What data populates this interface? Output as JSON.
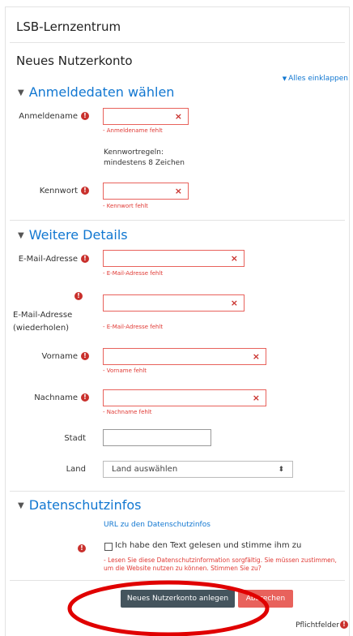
{
  "site": {
    "title": "LSB-Lernzentrum"
  },
  "page": {
    "title": "Neues Nutzerkonto",
    "collapse_all": "Alles einklappen"
  },
  "sections": {
    "login": {
      "title": "Anmeldedaten wählen",
      "username": {
        "label": "Anmeldename",
        "error": "- Anmeldename fehlt",
        "value": ""
      },
      "password_rules": "Kennwortregeln:",
      "password_rule_1": "mindestens 8 Zeichen",
      "password": {
        "label": "Kennwort",
        "error": "- Kennwort fehlt",
        "value": ""
      }
    },
    "details": {
      "title": "Weitere Details",
      "email": {
        "label": "E-Mail-Adresse",
        "error": "- E-Mail-Adresse fehlt"
      },
      "email2": {
        "label_line1": "E-Mail-Adresse",
        "label_line2": "(wiederholen)",
        "error": "- E-Mail-Adresse fehlt"
      },
      "firstname": {
        "label": "Vorname",
        "error": "- Vorname fehlt"
      },
      "lastname": {
        "label": "Nachname",
        "error": "- Nachname fehlt"
      },
      "city": {
        "label": "Stadt"
      },
      "country": {
        "label": "Land",
        "selected": "Land auswählen"
      }
    },
    "privacy": {
      "title": "Datenschutzinfos",
      "url_link": "URL zu den Datenschutzinfos",
      "agree_label": "Ich habe den Text gelesen und stimme ihm zu",
      "error": "- Lesen Sie diese Datenschutzinformation sorgfältig. Sie müssen zustimmen, um die Website nutzen zu können. Stimmen Sie zu?"
    }
  },
  "buttons": {
    "submit": "Neues Nutzerkonto anlegen",
    "cancel": "Abbrechen"
  },
  "footer": {
    "required_legend": "Pflichtfelder"
  },
  "icons": {
    "required": "exclamation-circle-icon",
    "clear": "x-icon",
    "collapse": "triangle-down-icon"
  },
  "colors": {
    "accent": "#1177d1",
    "error": "#c9302c",
    "primary_button": "#44545d",
    "cancel_button": "#e8625c",
    "annotation_circle": "#e00000"
  }
}
